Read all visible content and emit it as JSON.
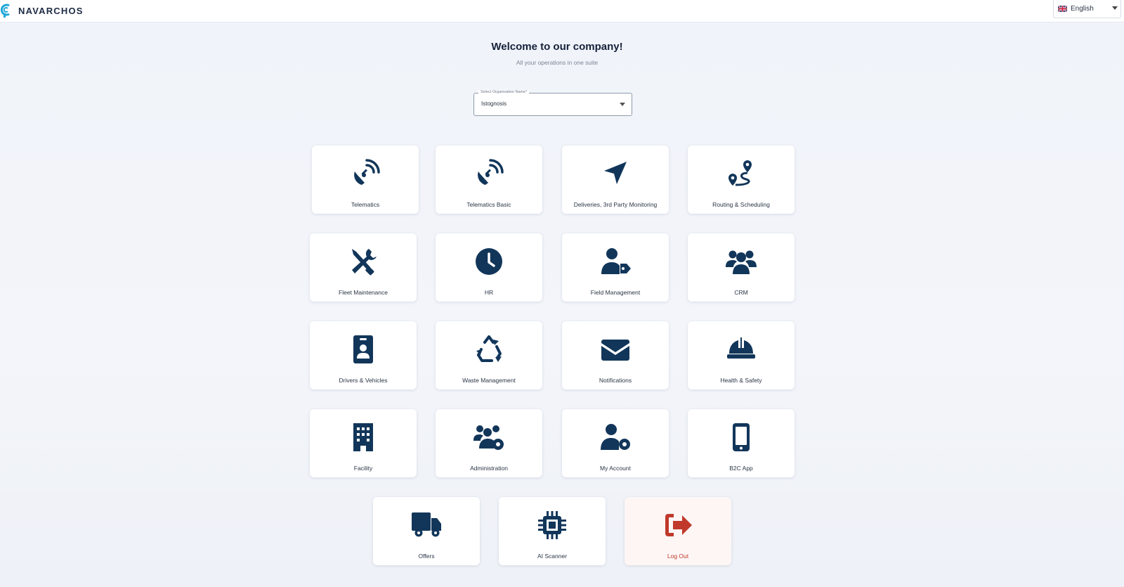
{
  "header": {
    "brand": "NAVARCHOS",
    "language": "English"
  },
  "welcome": {
    "title": "Welcome to our company!",
    "subtitle": "All your operations in one suite"
  },
  "organization_select": {
    "label": "Select Organization Name*",
    "value": "Istognosis"
  },
  "modules": [
    {
      "label": "Telematics",
      "icon": "satellite-dish-icon"
    },
    {
      "label": "Telematics Basic",
      "icon": "satellite-dish-icon"
    },
    {
      "label": "Deliveries, 3rd Party Monitoring",
      "icon": "location-arrow-icon"
    },
    {
      "label": "Routing & Scheduling",
      "icon": "route-icon"
    },
    {
      "label": "Fleet Maintenance",
      "icon": "screwdriver-wrench-icon"
    },
    {
      "label": "HR",
      "icon": "clock-icon"
    },
    {
      "label": "Field Management",
      "icon": "user-tag-icon"
    },
    {
      "label": "CRM",
      "icon": "users-icon"
    },
    {
      "label": "Drivers & Vehicles",
      "icon": "id-badge-icon"
    },
    {
      "label": "Waste Management",
      "icon": "recycle-icon"
    },
    {
      "label": "Notifications",
      "icon": "envelope-icon"
    },
    {
      "label": "Health & Safety",
      "icon": "helmet-icon"
    },
    {
      "label": "Facility",
      "icon": "building-icon"
    },
    {
      "label": "Administration",
      "icon": "users-gear-icon"
    },
    {
      "label": "My Account",
      "icon": "user-gear-icon"
    },
    {
      "label": "B2C App",
      "icon": "mobile-icon"
    },
    {
      "label": "Offers",
      "icon": "truck-icon"
    },
    {
      "label": "AI Scanner",
      "icon": "microchip-icon"
    },
    {
      "label": "Log Out",
      "icon": "sign-out-icon"
    }
  ],
  "colors": {
    "icon": "#12365a",
    "logout": "#c0392b",
    "brand_accent": "#1ea7d8"
  }
}
